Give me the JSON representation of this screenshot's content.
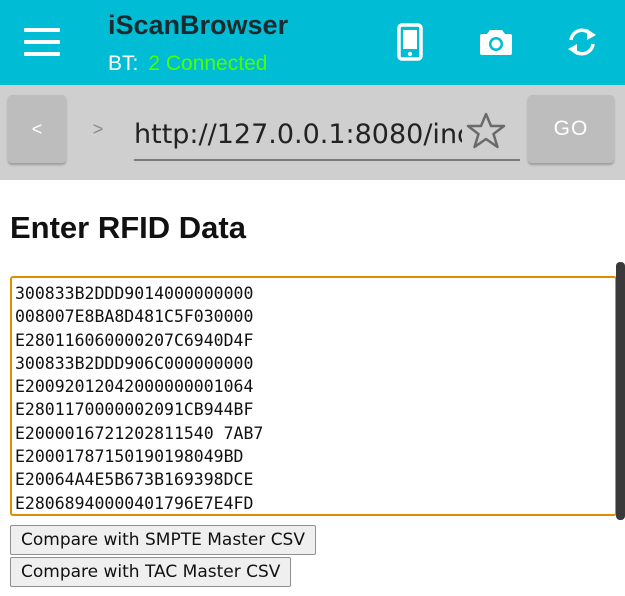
{
  "appbar": {
    "title": "iScanBrowser",
    "bt_label": "BT:",
    "bt_status": "2 Connected",
    "icons": [
      "menu-icon",
      "phone-icon",
      "camera-icon",
      "sync-icon"
    ],
    "color": "#00bcd4",
    "bt_status_color": "#4cff00"
  },
  "urlbar": {
    "back_label": "<",
    "forward_label": ">",
    "url": "http://127.0.0.1:8080/inc",
    "go_label": "GO",
    "star_icon": "star-outline-icon"
  },
  "page": {
    "heading": "Enter RFID Data",
    "rfid_text": "300833B2DDD9014000000000\n008007E8BA8D481C5F030000\nE280116060000207C6940D4F\n300833B2DDD906C000000000\nE20092012042000000001064\nE2801170000002091CB944BF\nE2000016721202811540 7AB7\nE20001787150190198049BD\nE20064A4E5B673B169398DCE\nE28068940000401796E7E4FD",
    "compare_smpte_label": "Compare with SMPTE Master CSV",
    "compare_tac_label": "Compare with TAC Master CSV",
    "accent_color": "#e08e00"
  }
}
